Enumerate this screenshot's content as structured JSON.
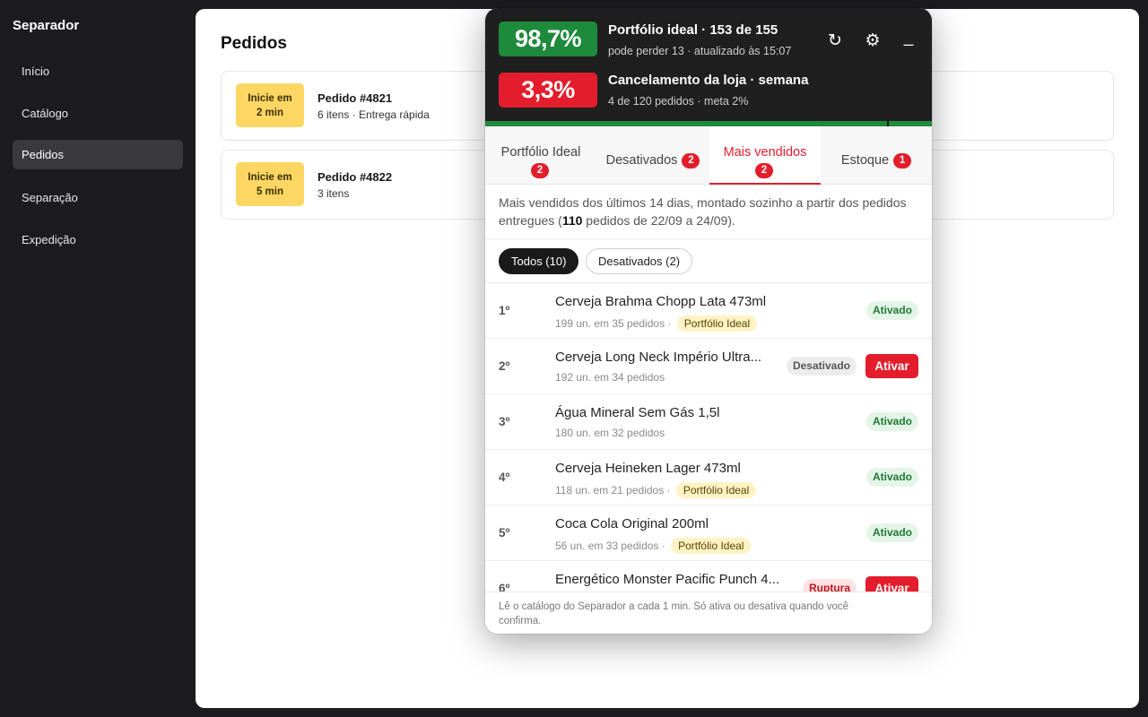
{
  "sidebar": {
    "brand": "Separador",
    "items": [
      {
        "label": "Início"
      },
      {
        "label": "Catálogo"
      },
      {
        "label": "Pedidos"
      },
      {
        "label": "Separação"
      },
      {
        "label": "Expedição"
      }
    ]
  },
  "main": {
    "title": "Pedidos",
    "orders": [
      {
        "badge_line1": "Inicie em",
        "badge_line2": "2 min",
        "title": "Pedido #4821",
        "sub": "6 itens · Entrega rápida"
      },
      {
        "badge_line1": "Inicie em",
        "badge_line2": "5 min",
        "title": "Pedido #4822",
        "sub": "3 itens"
      }
    ]
  },
  "panel": {
    "portfolio": {
      "value": "98,7%",
      "title": "Portfólio ideal · 153 de 155",
      "sub": "pode perder 13 · atualizado às 15:07",
      "progress_fraction": 0.987
    },
    "cancel": {
      "value": "3,3%",
      "title": "Cancelamento da loja · semana",
      "sub": "4 de 120 pedidos · meta 2%"
    },
    "buttons": {
      "refresh": "↻",
      "settings": "⚙",
      "minimize": "_"
    },
    "tabs": [
      {
        "label": "Portfólio Ideal",
        "count": "2"
      },
      {
        "label": "Desativados",
        "count": "2"
      },
      {
        "label": "Mais vendidos",
        "count": "2"
      },
      {
        "label": "Estoque",
        "count": "1"
      }
    ],
    "description": {
      "pre": "Mais vendidos dos últimos 14 dias, montado sozinho a partir dos pedidos entregues (",
      "bold": "110",
      "post": " pedidos de 22/09 a 24/09)."
    },
    "filters": {
      "all": "Todos (10)",
      "disabled": "Desativados (2)"
    },
    "products": [
      {
        "rank": "1º",
        "name": "Cerveja Brahma Chopp Lata 473ml",
        "meta": "199 un. em 35 pedidos ·",
        "tag": "Portfólio Ideal",
        "status": "Ativado"
      },
      {
        "rank": "2º",
        "name": "Cerveja Long Neck Império Ultra...",
        "meta": "192 un. em 34 pedidos",
        "status": "Desativado",
        "action": "Ativar"
      },
      {
        "rank": "3º",
        "name": "Água Mineral Sem Gás 1,5l",
        "meta": "180 un. em 32 pedidos",
        "status": "Ativado"
      },
      {
        "rank": "4º",
        "name": "Cerveja Heineken Lager 473ml",
        "meta": "118 un. em 21 pedidos ·",
        "tag": "Portfólio Ideal",
        "status": "Ativado"
      },
      {
        "rank": "5º",
        "name": "Coca Cola Original 200ml",
        "meta": "56 un. em 33 pedidos ·",
        "tag": "Portfólio Ideal",
        "status": "Ativado"
      },
      {
        "rank": "6º",
        "name": "Energético Monster Pacific Punch 4...",
        "status": "Ruptura",
        "action": "Ativar"
      }
    ],
    "footer": "Lê o catálogo do Separador a cada 1 min. Só ativa ou desativa quando você confirma."
  }
}
